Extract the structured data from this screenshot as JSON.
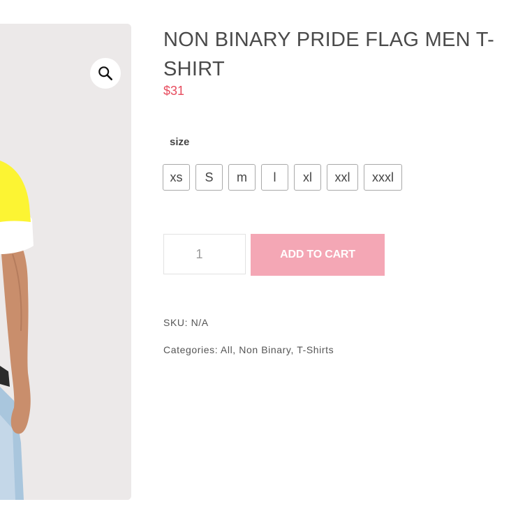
{
  "product": {
    "title": "NON BINARY PRIDE FLAG MEN T-SHIRT",
    "price": "$31"
  },
  "gallery": {
    "zoom_icon": "search-icon"
  },
  "size": {
    "label": "size",
    "options": [
      "xs",
      "S",
      "m",
      "l",
      "xl",
      "xxl",
      "xxxl"
    ]
  },
  "cart": {
    "quantity_value": "1",
    "add_label": "ADD TO CART"
  },
  "meta": {
    "sku_label": "SKU:",
    "sku_value": "N/A",
    "categories_label": "Categories:",
    "categories": [
      "All",
      "Non Binary",
      "T-Shirts"
    ],
    "separator": ", "
  },
  "colors": {
    "price": "#e74c5e",
    "button": "#f4a7b5",
    "shirt_yellow": "#fcf433"
  }
}
